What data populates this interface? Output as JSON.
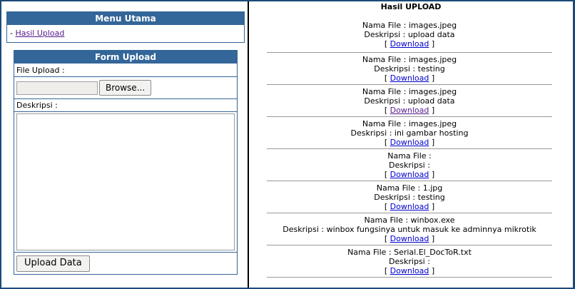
{
  "menu": {
    "title": "Menu Utama",
    "prefix": "-",
    "items": [
      {
        "label": "Hasil Upload"
      }
    ]
  },
  "form": {
    "title": "Form Upload",
    "file_label": "File Upload :",
    "browse_label": "Browse...",
    "description_label": "Deskripsi :",
    "description_value": "",
    "submit_label": "Upload Data"
  },
  "results": {
    "title": "Hasil UPLOAD",
    "name_prefix": "Nama File :",
    "desc_prefix": "Deskripsi :",
    "download_label": "Download",
    "bracket_open": "[",
    "bracket_close": "]",
    "items": [
      {
        "file": "images.jpeg",
        "desc": "upload data",
        "visited": false
      },
      {
        "file": "images.jpeg",
        "desc": "testing",
        "visited": false
      },
      {
        "file": "images.jpeg",
        "desc": "upload data",
        "visited": true
      },
      {
        "file": "images.jpeg",
        "desc": "ini gambar hosting",
        "visited": false
      },
      {
        "file": "",
        "desc": "",
        "visited": false
      },
      {
        "file": "1.jpg",
        "desc": "testing",
        "visited": false
      },
      {
        "file": "winbox.exe",
        "desc": "winbox fungsinya untuk masuk ke adminnya mikrotik",
        "visited": false
      },
      {
        "file": "Serial.El_DocToR.txt",
        "desc": "",
        "visited": false
      }
    ]
  },
  "colors": {
    "header_bg": "#336699",
    "frame": "#1a4a7a",
    "link": "#0000cc",
    "visited_link": "#551a8b"
  }
}
